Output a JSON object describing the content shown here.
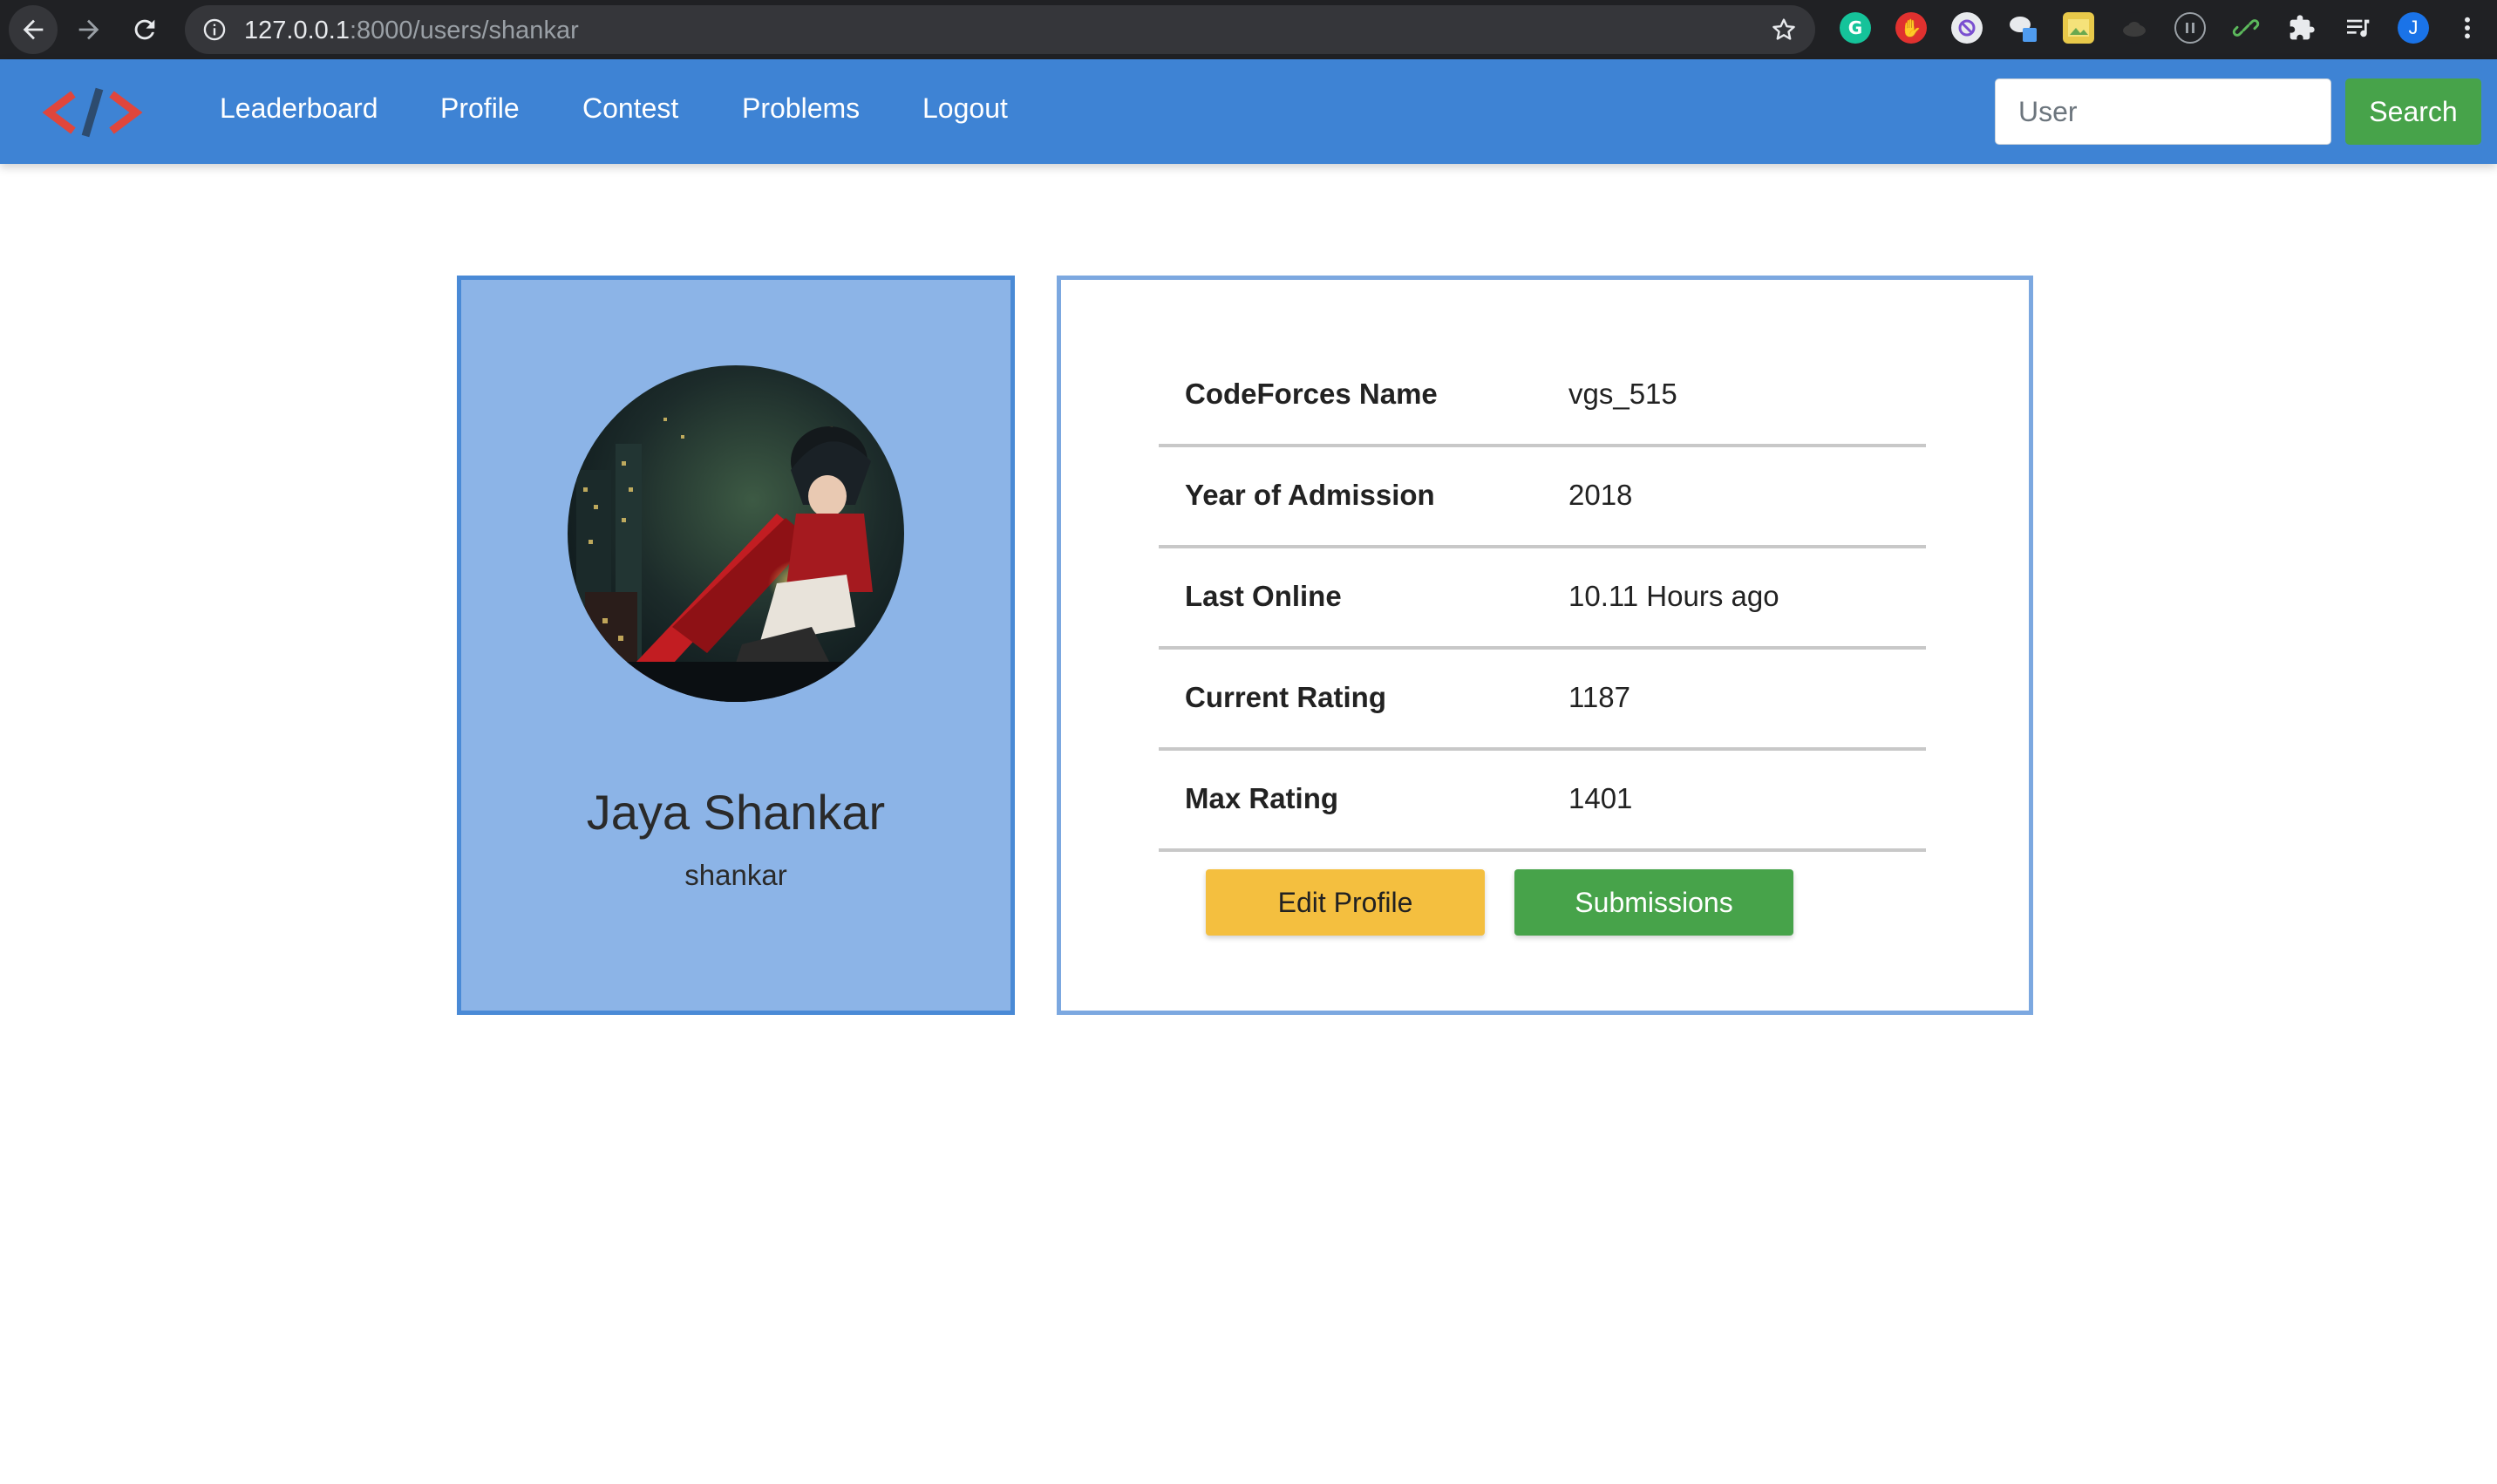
{
  "browser": {
    "url_host": "127.0.0.1",
    "url_path": ":8000/users/shankar",
    "profile_initial": "J",
    "icons": {
      "back": "arrow-left-icon",
      "forward": "arrow-right-icon",
      "reload": "reload-icon",
      "site_info": "info-icon",
      "bookmark": "star-icon",
      "extensions": [
        "grammarly-icon",
        "adblock-icon",
        "block-icon",
        "chat-extension-icon",
        "image-extension-icon",
        "cloud-extension-icon",
        "pause-icon",
        "link-icon",
        "puzzle-icon",
        "playlist-icon",
        "avatar-icon",
        "kebab-menu-icon"
      ]
    }
  },
  "navbar": {
    "logo": "code-brackets-logo",
    "links": [
      "Leaderboard",
      "Profile",
      "Contest",
      "Problems",
      "Logout"
    ],
    "search_placeholder": "User",
    "search_button": "Search",
    "colors": {
      "bar": "#3e83d4",
      "search_button": "#47a34a"
    }
  },
  "profile": {
    "full_name": "Jaya Shankar",
    "username": "shankar",
    "avatar": "anime-avatar-image"
  },
  "details": {
    "rows": [
      {
        "label": "CodeForces Name",
        "value": "vgs_515"
      },
      {
        "label": "Year of Admission",
        "value": "2018"
      },
      {
        "label": "Last Online",
        "value": "10.11 Hours ago"
      },
      {
        "label": "Current Rating",
        "value": "1187"
      },
      {
        "label": "Max Rating",
        "value": "1401"
      }
    ],
    "edit_button": "Edit Profile",
    "submissions_button": "Submissions",
    "colors": {
      "edit": "#f4bf3f",
      "submissions": "#47a34a"
    }
  }
}
